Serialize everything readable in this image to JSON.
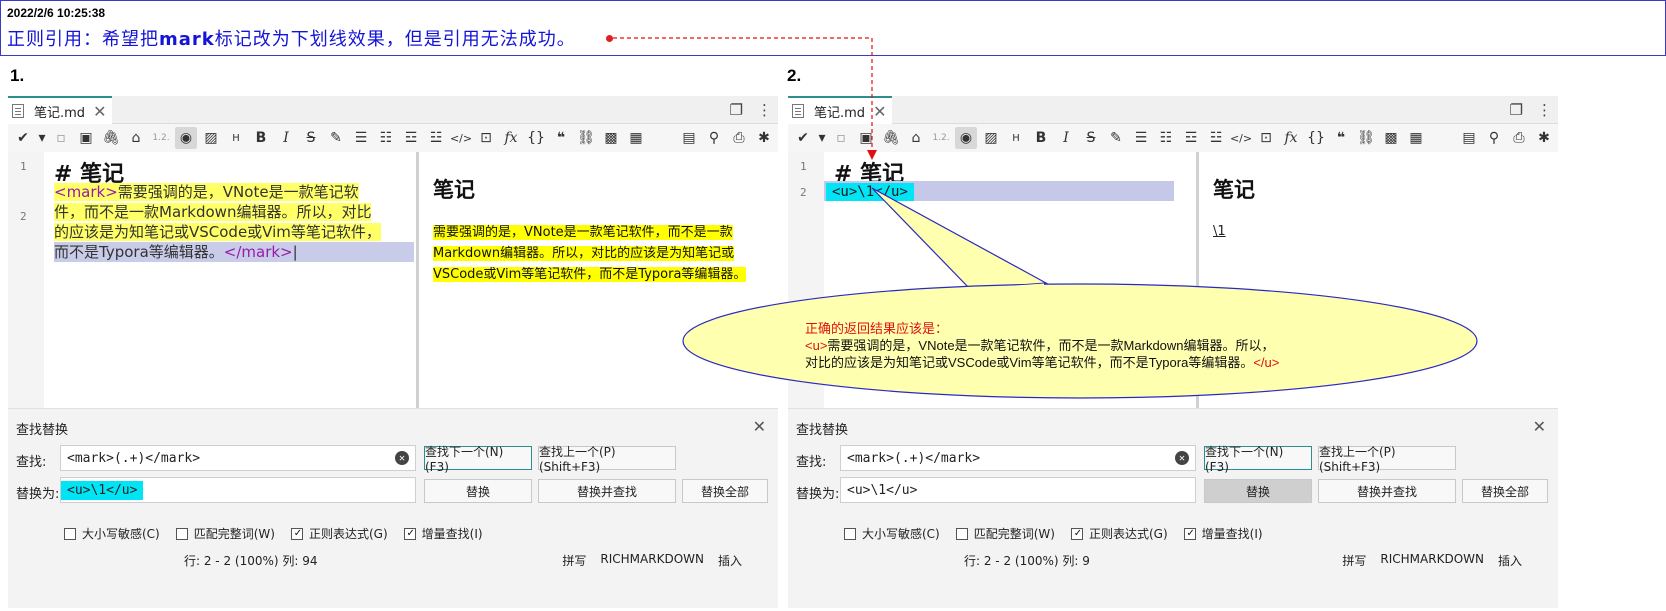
{
  "banner": {
    "timestamp": "2022/2/6 10:25:38",
    "message_pre": "正则引用：希望把",
    "message_bold": "mark",
    "message_post": "标记改为下划线效果，但是引用无法成功。"
  },
  "panel1": {
    "number": "1.",
    "tab_label": "笔记.md",
    "line_numbers": [
      "1",
      "2"
    ],
    "src_heading": "# 笔记",
    "src_open_tag": "<mark>",
    "src_line_a": "需要强调的是，VNote是一款笔记软",
    "src_line_b": "件，而不是一款Markdown编辑器。所以，对比",
    "src_line_c": "的应该是为知笔记或VSCode或Vim等笔记软件，",
    "src_line_d": "而不是Typora等编辑器。",
    "src_close_tag": "</mark>",
    "preview_heading": "笔记",
    "preview_line_a": "需要强调的是，VNote是一款笔记软件，而不是一款",
    "preview_line_b": "Markdown编辑器。所以，对比的应该是为知笔记或",
    "preview_line_c": "VSCode或Vim等笔记软件，而不是Typora等编辑器。",
    "find": {
      "title": "查找替换",
      "find_label": "查找:",
      "find_value": "<mark>(.+)</mark>",
      "replace_label": "替换为:",
      "replace_value": "<u>\\1</u>",
      "btn_find_next": "查找下一个(N) (F3)",
      "btn_find_prev": "查找上一个(P) (Shift+F3)",
      "btn_replace": "替换",
      "btn_replace_find": "替换并查找",
      "btn_replace_all": "替换全部",
      "opt_case": "大小写敏感(C)",
      "opt_whole": "匹配完整词(W)",
      "opt_regex": "正则表达式(G)",
      "opt_incremental": "增量查找(I)"
    },
    "status": {
      "position": "行: 2 - 2 (100%)   列: 94",
      "spell": "拼写",
      "mode": "RICHMARKDOWN",
      "insert": "插入"
    }
  },
  "panel2": {
    "number": "2.",
    "tab_label": "笔记.md",
    "line_numbers": [
      "1",
      "2"
    ],
    "src_heading": "# 笔记",
    "src_line2": "<u>\\1</u>",
    "preview_heading": "笔记",
    "preview_text": "\\1",
    "find": {
      "title": "查找替换",
      "find_label": "查找:",
      "find_value": "<mark>(.+)</mark>",
      "replace_label": "替换为:",
      "replace_value": "<u>\\1</u>",
      "btn_find_next": "查找下一个(N) (F3)",
      "btn_find_prev": "查找上一个(P) (Shift+F3)",
      "btn_replace": "替换",
      "btn_replace_find": "替换并查找",
      "btn_replace_all": "替换全部",
      "opt_case": "大小写敏感(C)",
      "opt_whole": "匹配完整词(W)",
      "opt_regex": "正则表达式(G)",
      "opt_incremental": "增量查找(I)"
    },
    "status": {
      "position": "行: 2 - 2 (100%)   列: 9",
      "spell": "拼写",
      "mode": "RICHMARKDOWN",
      "insert": "插入"
    }
  },
  "callout": {
    "title": "正确的返回结果应该是：",
    "open_tag": "<u>",
    "line1": "需要强调的是，VNote是一款笔记软件，而不是一款Markdown编辑器。所以，",
    "line2": "对比的应该是为知笔记或VSCode或Vim等笔记软件，而不是Typora等编辑器。",
    "close_tag": "</u>"
  },
  "colors": {
    "banner_text": "#1414d8",
    "accent_teal": "#2d8e8e",
    "highlight_yellow": "#ffff66",
    "highlight_cyan": "#00e5f5",
    "callout_fill": "#ffffb0",
    "callout_stroke": "#2a2ac0",
    "annotation_red": "#e01010"
  }
}
